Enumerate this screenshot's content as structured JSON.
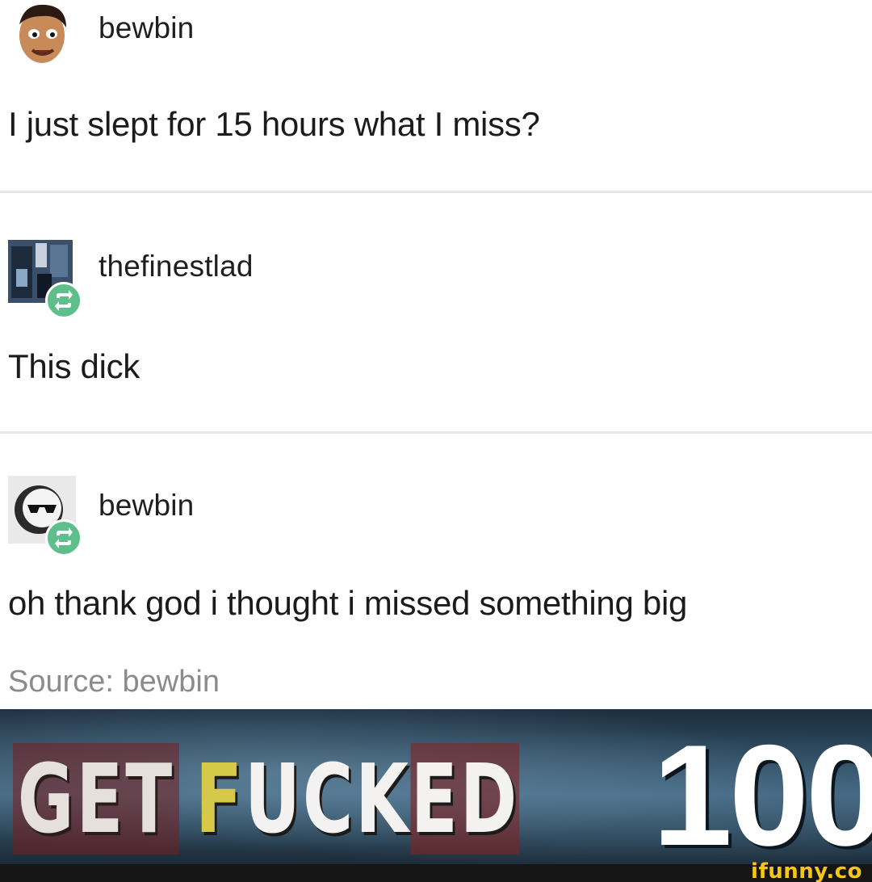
{
  "posts": [
    {
      "username": "bewbin",
      "avatar": "cartoon-face-avatar",
      "text": "I just slept for 15 hours what I miss?"
    },
    {
      "username": "thefinestlad",
      "avatar": "photo-avatar",
      "reblog_icon": "reblog-icon",
      "text": "This dick"
    },
    {
      "username": "bewbin",
      "avatar": "sunglasses-avatar",
      "reblog_icon": "reblog-icon",
      "text": "oh thank god i thought i missed something big"
    }
  ],
  "source": {
    "label": "Source:",
    "user": "bewbin"
  },
  "banner": {
    "word1": "GET",
    "word2_first": "F",
    "word2_middle": "UCK",
    "word2_rest": "ED",
    "score": "100"
  },
  "watermark": "ifunny.co",
  "colors": {
    "reblog": "#5fbf8a",
    "source_text": "#8b8b8b",
    "watermark": "#f5c518"
  }
}
